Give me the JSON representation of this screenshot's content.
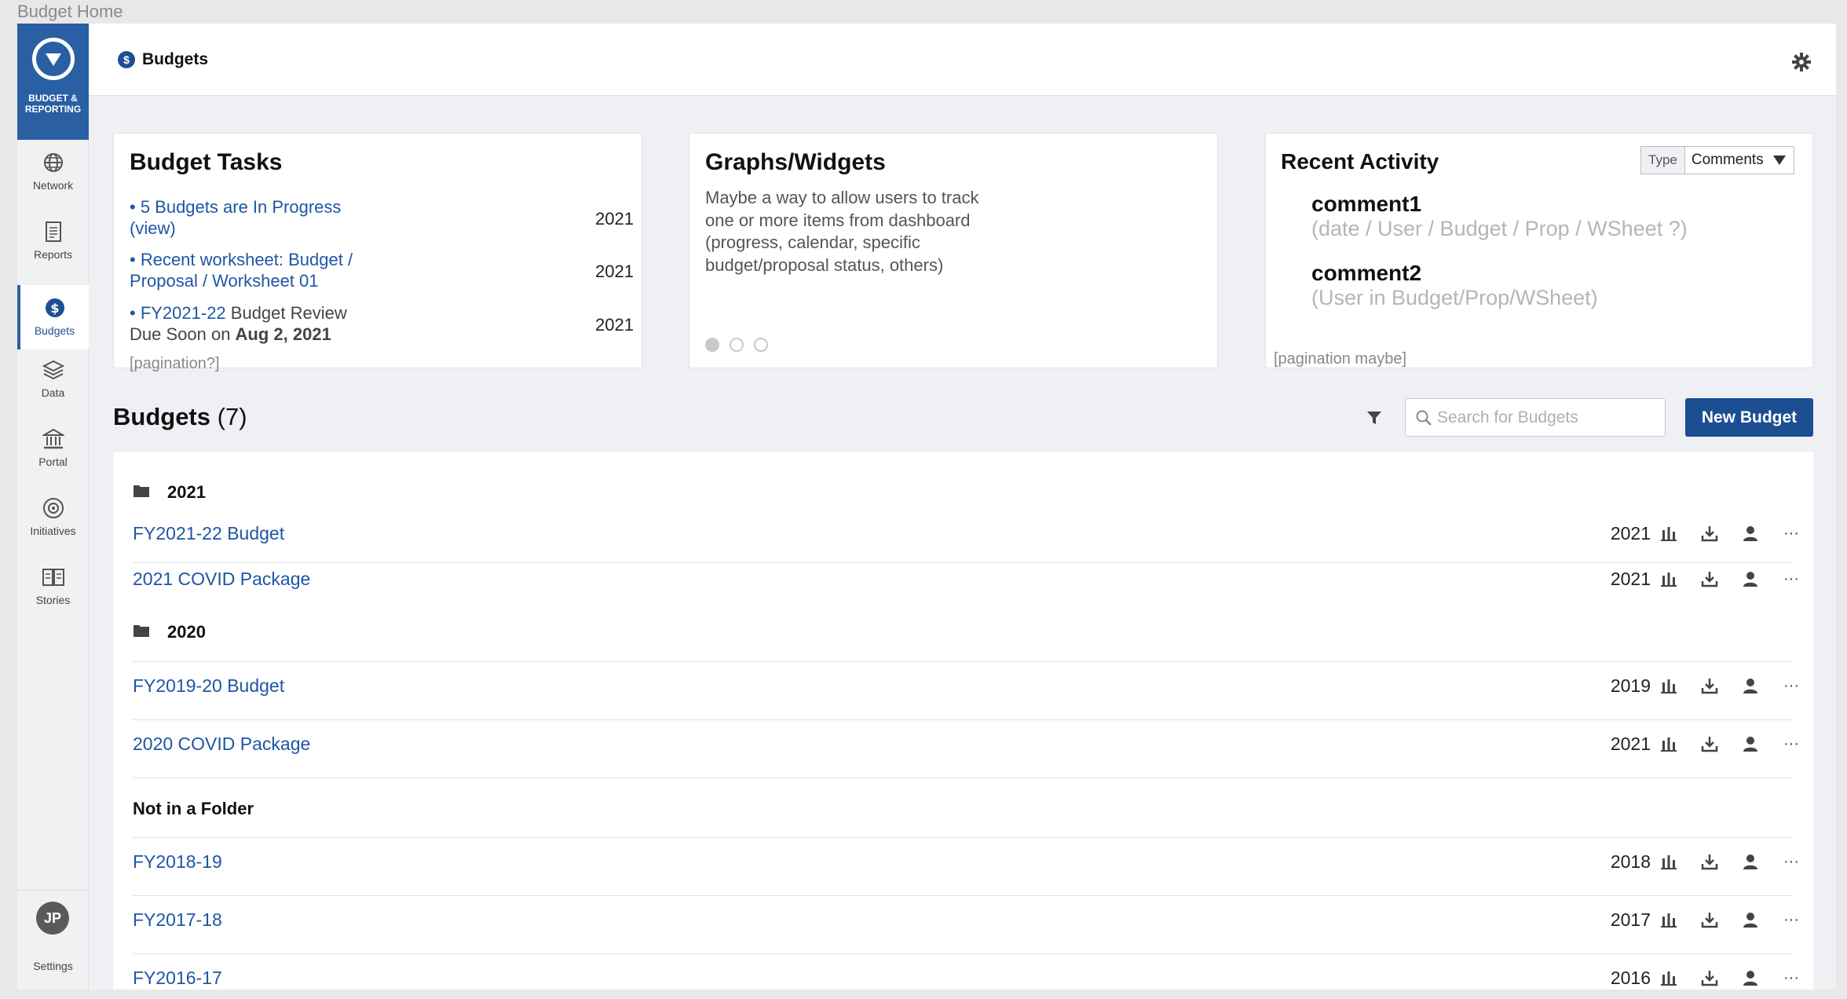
{
  "window": {
    "title": "Budget Home"
  },
  "sidebar": {
    "brand_label": "BUDGET & REPORTING",
    "items": [
      {
        "label": "Network",
        "icon": "globe-icon"
      },
      {
        "label": "Reports",
        "icon": "report-icon"
      },
      {
        "label": "Budgets",
        "icon": "dollar-icon",
        "active": true
      },
      {
        "label": "Data",
        "icon": "layers-icon"
      },
      {
        "label": "Portal",
        "icon": "building-icon"
      },
      {
        "label": "Initiatives",
        "icon": "initiative-icon"
      },
      {
        "label": "Stories",
        "icon": "book-icon"
      }
    ],
    "avatar_initials": "JP",
    "settings_label": "Settings"
  },
  "header": {
    "title": "Budgets"
  },
  "tasks": {
    "title": "Budget Tasks",
    "items": [
      {
        "link": "• 5 Budgets are In Progress (view)",
        "year": "2021"
      },
      {
        "link": "• Recent worksheet: Budget / Proposal / Worksheet 01",
        "year": "2021"
      },
      {
        "link": "• FY2021-22",
        "text": " Budget Review Due Soon on ",
        "bold": "Aug 2, 2021",
        "year": "2021"
      }
    ],
    "pagination": "[pagination?]"
  },
  "widgets": {
    "title": "Graphs/Widgets",
    "text": "Maybe a way to allow users to track one or more items from dashboard (progress, calendar, specific budget/proposal status, others)"
  },
  "activity": {
    "title": "Recent Activity",
    "type_label": "Type",
    "type_value": "Comments",
    "comments": [
      {
        "title": "comment1",
        "meta": "(date / User / Budget / Prop / WSheet ?)"
      },
      {
        "title": "comment2",
        "meta": "(User in Budget/Prop/WSheet)"
      }
    ],
    "pagination": "[pagination maybe]"
  },
  "budgets": {
    "title": "Budgets",
    "count": "(7)",
    "search_placeholder": "Search for Budgets",
    "new_button": "New Budget",
    "folders": [
      {
        "name": "2021",
        "rows": [
          {
            "name": "FY2021-22 Budget",
            "year": "2021"
          },
          {
            "name": "2021 COVID Package",
            "year": "2021"
          }
        ]
      },
      {
        "name": "2020",
        "rows": [
          {
            "name": "FY2019-20 Budget",
            "year": "2019"
          },
          {
            "name": "2020 COVID Package",
            "year": "2021"
          }
        ]
      }
    ],
    "no_folder_label": "Not in a Folder",
    "no_folder_rows": [
      {
        "name": "FY2018-19",
        "year": "2018"
      },
      {
        "name": "FY2017-18",
        "year": "2017"
      },
      {
        "name": "FY2016-17",
        "year": "2016"
      }
    ],
    "more_glyph": "···"
  }
}
